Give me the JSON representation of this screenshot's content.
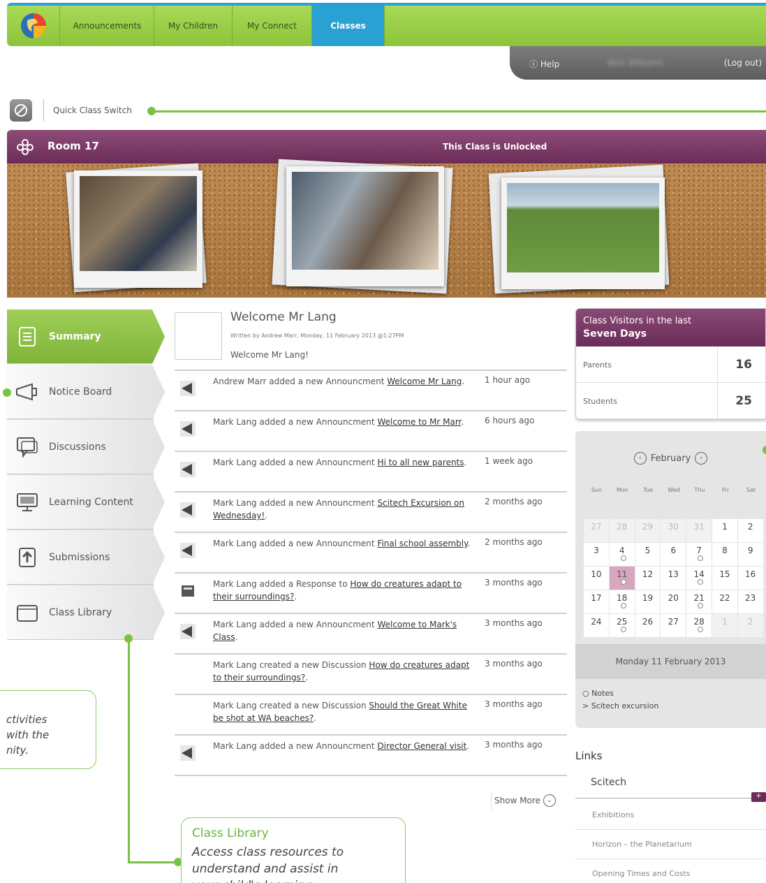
{
  "nav": {
    "tabs": [
      "Announcements",
      "My Children",
      "My Connect",
      "Classes"
    ],
    "active": "Classes"
  },
  "userbar": {
    "help": "Help",
    "username": "Nick Williams",
    "logout": "(Log out)"
  },
  "quick_switch": {
    "label": "Quick Class Switch"
  },
  "class": {
    "name": "Room 17",
    "status": "This Class is Unlocked"
  },
  "sidebar": {
    "items": [
      {
        "label": "Summary",
        "icon": "document-icon"
      },
      {
        "label": "Notice Board",
        "icon": "megaphone-icon"
      },
      {
        "label": "Discussions",
        "icon": "speech-bubble-icon"
      },
      {
        "label": "Learning Content",
        "icon": "monitor-icon"
      },
      {
        "label": "Submissions",
        "icon": "upload-icon"
      },
      {
        "label": "Class Library",
        "icon": "folder-icon"
      }
    ]
  },
  "welcome": {
    "title": "Welcome Mr Lang",
    "meta": "Written by Andrew Marr, Monday, 11 February 2013 @1:27PM",
    "body": "Welcome Mr Lang!"
  },
  "feed": [
    {
      "pre": "Andrew Marr added a new Announcment ",
      "link": "Welcome Mr Lang",
      "post": ".",
      "time": "1 hour ago",
      "icon": "announcement-icon"
    },
    {
      "pre": "Mark Lang added a new Announcment ",
      "link": "Welcome to Mr Marr",
      "post": ".",
      "time": "6 hours ago",
      "icon": "announcement-icon"
    },
    {
      "pre": "Mark Lang added a new Announcment ",
      "link": "Hi to all new parents",
      "post": ".",
      "time": "1 week ago",
      "icon": "announcement-icon"
    },
    {
      "pre": "Mark Lang added a new Announcment ",
      "link": "Scitech Excursion on Wednesday!",
      "post": ".",
      "time": "2 months ago",
      "icon": "announcement-icon"
    },
    {
      "pre": "Mark Lang added a new Announcment ",
      "link": "Final school assembly",
      "post": ".",
      "time": "2 months ago",
      "icon": "announcement-icon"
    },
    {
      "pre": "Mark Lang added a Response to ",
      "link": "How do creatures adapt to their surroundings?",
      "post": ".",
      "time": "3 months ago",
      "icon": "response-icon"
    },
    {
      "pre": "Mark Lang added a new Announcment ",
      "link": "Welcome to Mark's Class",
      "post": ".",
      "time": "3 months ago",
      "icon": "announcement-icon"
    },
    {
      "pre": "Mark Lang created a new Discussion ",
      "link": "How do creatures adapt to their surroundings?",
      "post": ".",
      "time": "3 months ago",
      "icon": ""
    },
    {
      "pre": "Mark Lang created a new Discussion ",
      "link": "Should the Great White be shot at WA beaches?",
      "post": ".",
      "time": "3 months ago",
      "icon": ""
    },
    {
      "pre": "Mark Lang added a new Announcment ",
      "link": "Director General visit",
      "post": ".",
      "time": "3 months ago",
      "icon": "announcement-icon"
    }
  ],
  "show_more": "Show More",
  "visitors": {
    "title_line1": "Class Visitors in the last",
    "title_line2": "Seven Days",
    "rows": [
      {
        "label": "Parents",
        "value": "16"
      },
      {
        "label": "Students",
        "value": "25"
      }
    ]
  },
  "calendar": {
    "month": "February",
    "days": [
      "Sun",
      "Mon",
      "Tue",
      "Wed",
      "Thu",
      "Fri",
      "Sat"
    ],
    "cells": [
      {
        "d": "27",
        "other": true
      },
      {
        "d": "28",
        "other": true
      },
      {
        "d": "29",
        "other": true
      },
      {
        "d": "30",
        "other": true
      },
      {
        "d": "31",
        "other": true
      },
      {
        "d": "1"
      },
      {
        "d": "2"
      },
      {
        "d": "3"
      },
      {
        "d": "4",
        "ev": true
      },
      {
        "d": "5"
      },
      {
        "d": "6"
      },
      {
        "d": "7",
        "ev": true
      },
      {
        "d": "8"
      },
      {
        "d": "9"
      },
      {
        "d": "10"
      },
      {
        "d": "11",
        "ev": true,
        "today": true
      },
      {
        "d": "12"
      },
      {
        "d": "13"
      },
      {
        "d": "14",
        "ev": true
      },
      {
        "d": "15"
      },
      {
        "d": "16"
      },
      {
        "d": "17"
      },
      {
        "d": "18",
        "ev": true
      },
      {
        "d": "19"
      },
      {
        "d": "20"
      },
      {
        "d": "21",
        "ev": true
      },
      {
        "d": "22"
      },
      {
        "d": "23"
      },
      {
        "d": "24"
      },
      {
        "d": "25",
        "ev": true
      },
      {
        "d": "26"
      },
      {
        "d": "27"
      },
      {
        "d": "28",
        "ev": true
      },
      {
        "d": "1",
        "other": true
      },
      {
        "d": "2",
        "other": true
      }
    ],
    "selected_date": "Monday 11 February 2013",
    "notes": [
      "Notes",
      "Scitech excursion"
    ]
  },
  "links": {
    "title": "Links",
    "main": "Scitech",
    "items": [
      "Exhibitions",
      "Horizon – the Planetarium",
      "Opening Times and Costs"
    ]
  },
  "callouts": {
    "left_text": [
      "ctivities",
      "with the",
      "nity."
    ],
    "right_title": "Class Library",
    "right_text": [
      "Access class resources to",
      "understand and assist in",
      "your child's learning"
    ]
  },
  "colors": {
    "green": "#8cc43a",
    "blue": "#2aa1d3",
    "purple": "#6b2c58"
  }
}
